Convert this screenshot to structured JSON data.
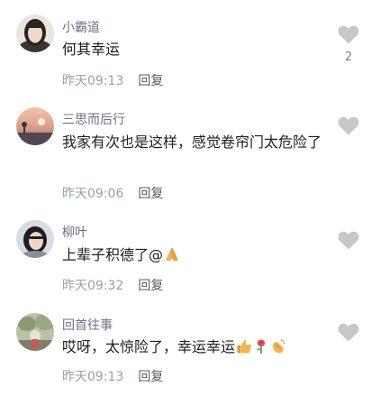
{
  "comments": [
    {
      "username": "小霸道",
      "text": "何其幸运",
      "time": "昨天09:13",
      "reply_label": "回复",
      "like_count": "2",
      "liked": false,
      "emoji": []
    },
    {
      "username": "三思而后行",
      "text": "我家有次也是这样，感觉卷帘门太危险了",
      "time": "昨天09:06",
      "reply_label": "回复",
      "like_count": "",
      "liked": false,
      "emoji": []
    },
    {
      "username": "柳叶",
      "text": "上辈子积德了@",
      "time": "昨天09:32",
      "reply_label": "回复",
      "like_count": "",
      "liked": false,
      "emoji": [
        "pray-hands-emoji"
      ]
    },
    {
      "username": "回首往事",
      "text": "哎呀，太惊险了，幸运幸运",
      "time": "昨天09:13",
      "reply_label": "回复",
      "like_count": "",
      "liked": false,
      "emoji": [
        "thumbs-up-emoji",
        "rose-emoji",
        "clapping-hands-emoji"
      ]
    }
  ],
  "colors": {
    "username": "#6b7483",
    "text": "#1e1e1e",
    "meta": "#9aa0a8",
    "heart": "#c8c8c8"
  }
}
